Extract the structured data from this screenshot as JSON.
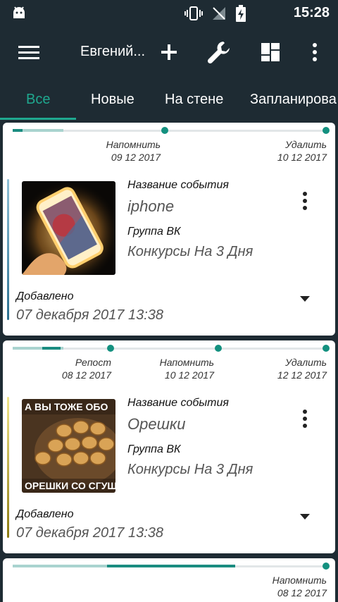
{
  "status_bar": {
    "time": "15:28",
    "icons": [
      "android-icon",
      "vibrate-icon",
      "no-signal-icon",
      "battery-charging-icon"
    ]
  },
  "app_bar": {
    "title": "Евгений...",
    "icons": [
      "menu-icon",
      "plus-icon",
      "wrench-icon",
      "dashboard-icon",
      "more-vert-icon"
    ]
  },
  "tabs": [
    {
      "label": "Все",
      "active": true
    },
    {
      "label": "Новые",
      "active": false
    },
    {
      "label": "На стене",
      "active": false
    },
    {
      "label": "Запланирова",
      "active": false
    }
  ],
  "colors": {
    "background": "#1e2b33",
    "accent": "#1fa88f",
    "timeline_dark": "#1a8c80",
    "timeline_light": "#a9d3cf"
  },
  "cards": [
    {
      "timeline": [
        {
          "label": "Напомнить",
          "date": "09 12 2017"
        },
        {
          "label": "Удалить",
          "date": "10 12 2017"
        }
      ],
      "event_label": "Название события",
      "event_name": "iphone",
      "group_label": "Группа ВК",
      "group_name": "Конкурсы На 3 Дня",
      "added_label": "Добавлено",
      "added_date": "07 декабря 2017 13:38",
      "accent_color": "#2a6f8f"
    },
    {
      "timeline": [
        {
          "label": "Репост",
          "date": "08 12 2017"
        },
        {
          "label": "Напомнить",
          "date": "10 12 2017"
        },
        {
          "label": "Удалить",
          "date": "12 12 2017"
        }
      ],
      "event_label": "Название события",
      "event_name": "Орешки",
      "group_label": "Группа ВК",
      "group_name": "Конкурсы На 3 Дня",
      "added_label": "Добавлено",
      "added_date": "07 декабря 2017 13:38",
      "image_caption_top": "А ВЫ ТОЖЕ ОБО",
      "image_caption_bottom": "ОРЕШКИ СО СГУЩ",
      "accent_color": "#8a7a10"
    },
    {
      "timeline": [
        {
          "label": "Напомнить",
          "date": "08 12 2017"
        }
      ]
    }
  ]
}
